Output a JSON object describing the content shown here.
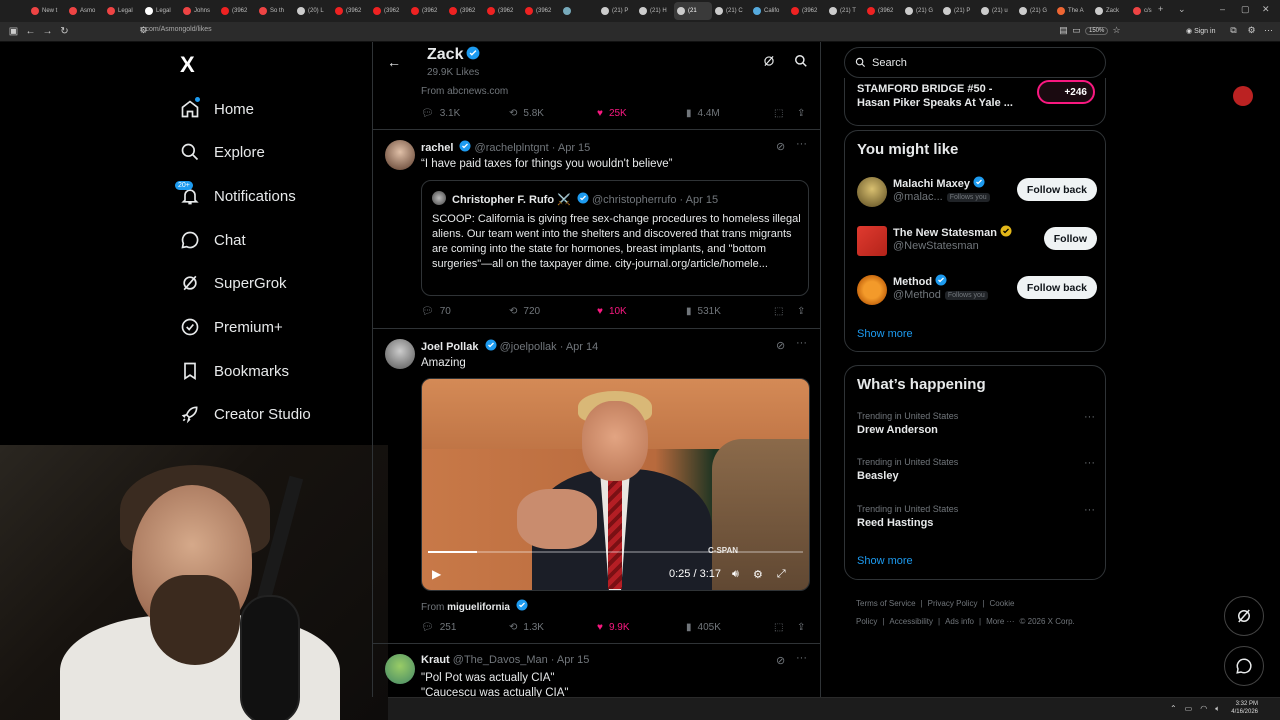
{
  "browser": {
    "tabs": [
      {
        "label": "New t",
        "color": "#e44"
      },
      {
        "label": "Asmo",
        "color": "#e44"
      },
      {
        "label": "Legal",
        "color": "#e44"
      },
      {
        "label": "Legal",
        "color": "#fff"
      },
      {
        "label": "Johns",
        "color": "#e44"
      },
      {
        "label": "(3962",
        "color": "#e22"
      },
      {
        "label": "So th",
        "color": "#e44"
      },
      {
        "label": "(20) L",
        "color": "#ccc"
      },
      {
        "label": "(3962",
        "color": "#e22"
      },
      {
        "label": "(3962",
        "color": "#e22"
      },
      {
        "label": "(3962",
        "color": "#e22"
      },
      {
        "label": "(3962",
        "color": "#e22"
      },
      {
        "label": "(3962",
        "color": "#e22"
      },
      {
        "label": "(3962",
        "color": "#e22"
      },
      {
        "label": "",
        "color": "#7ab"
      },
      {
        "label": "(21) P",
        "color": "#ccc"
      },
      {
        "label": "(21) H",
        "color": "#ccc"
      },
      {
        "label": "(21",
        "color": "#ccc"
      },
      {
        "label": "(21) C",
        "color": "#ccc"
      },
      {
        "label": "Califo",
        "color": "#5ad"
      },
      {
        "label": "(3962",
        "color": "#e22"
      },
      {
        "label": "(21) T",
        "color": "#ccc"
      },
      {
        "label": "(3962",
        "color": "#e22"
      },
      {
        "label": "(21) G",
        "color": "#ccc"
      },
      {
        "label": "(21) P",
        "color": "#ccc"
      },
      {
        "label": "(21) u",
        "color": "#ccc"
      },
      {
        "label": "(21) G",
        "color": "#ccc"
      },
      {
        "label": "The A",
        "color": "#e63"
      },
      {
        "label": "Zack",
        "color": "#ccc"
      },
      {
        "label": "c/s",
        "color": "#e44"
      }
    ],
    "active_tab_index": 17,
    "url": "x.com/Asmongold/likes",
    "zoom": "150%",
    "signin": "Sign in"
  },
  "nav": {
    "logo": "X",
    "notif_badge": "20+",
    "items": [
      {
        "label": "Home",
        "icon": "home-icon"
      },
      {
        "label": "Explore",
        "icon": "search-icon"
      },
      {
        "label": "Notifications",
        "icon": "bell-icon"
      },
      {
        "label": "Chat",
        "icon": "chat-icon"
      },
      {
        "label": "SuperGrok",
        "icon": "grok-icon"
      },
      {
        "label": "Premium+",
        "icon": "premium-icon"
      },
      {
        "label": "Bookmarks",
        "icon": "bookmark-icon"
      },
      {
        "label": "Creator Studio",
        "icon": "rocket-icon"
      }
    ]
  },
  "header": {
    "name": "Zack",
    "subtitle": "29.9K Likes"
  },
  "tweets": [
    {
      "source": "From abcnews.com",
      "replies": "3.1K",
      "reposts": "5.8K",
      "likes": "25K",
      "views": "4.4M"
    },
    {
      "name": "rachel",
      "handle": "@rachelplntgnt",
      "date": "· Apr 15",
      "text": "“I have paid taxes for things you wouldn't believe”",
      "quote": {
        "name": "Christopher F. Rufo ⚔️",
        "handle": "@christopherrufo",
        "date": "· Apr 15",
        "text": "SCOOP: California is giving free sex-change procedures to homeless illegal aliens. Our team went into the shelters and discovered that trans migrants are coming into the state for hormones, breast implants, and \"bottom surgeries\"—all on the taxpayer dime. city-journal.org/article/homele..."
      },
      "replies": "70",
      "reposts": "720",
      "likes": "10K",
      "views": "531K"
    },
    {
      "name": "Joel Pollak",
      "handle": "@joelpollak",
      "date": "· Apr 14",
      "text": "Amazing",
      "video": {
        "time": "0:25 / 3:17",
        "watermark": "C-SPAN",
        "progress": 0.13
      },
      "from_label": "From",
      "from_name": "miguelifornia",
      "replies": "251",
      "reposts": "1.3K",
      "likes": "9.9K",
      "views": "405K"
    },
    {
      "name": "Kraut",
      "handle": "@The_Davos_Man",
      "date": "· Apr 15",
      "line1": "\"Pol Pot was actually CIA\"",
      "line2": "\"Caucescu was actually CIA\""
    }
  ],
  "right": {
    "search_placeholder": "Search",
    "space": {
      "title": "STAMFORD BRIDGE #50 - Hasan Piker Speaks At Yale ...",
      "listeners": "+246"
    },
    "you_might_like": {
      "title": "You might like",
      "users": [
        {
          "name": "Malachi Maxey",
          "handle": "@malac...",
          "follows_you": "Follows you",
          "button": "Follow back",
          "verified": "blue"
        },
        {
          "name": "The New Statesman",
          "handle": "@NewStatesman",
          "follows_you": "",
          "button": "Follow",
          "verified": "gold"
        },
        {
          "name": "Method",
          "handle": "@Method",
          "follows_you": "Follows you",
          "button": "Follow back",
          "verified": "blue"
        }
      ],
      "show_more": "Show more"
    },
    "happening": {
      "title": "What’s happening",
      "trends": [
        {
          "category": "Trending in United States",
          "name": "Drew Anderson"
        },
        {
          "category": "Trending in United States",
          "name": "Beasley"
        },
        {
          "category": "Trending in United States",
          "name": "Reed Hastings"
        }
      ],
      "show_more": "Show more"
    },
    "footer": [
      "Terms of Service",
      "|",
      "Privacy Policy",
      "|",
      "Cookie Policy",
      "|",
      "Accessibility",
      "|",
      "Ads info",
      "|",
      "More ···",
      "© 2026 X Corp."
    ]
  },
  "taskbar": {
    "time": "3:32 PM",
    "date": "4/16/2026"
  }
}
